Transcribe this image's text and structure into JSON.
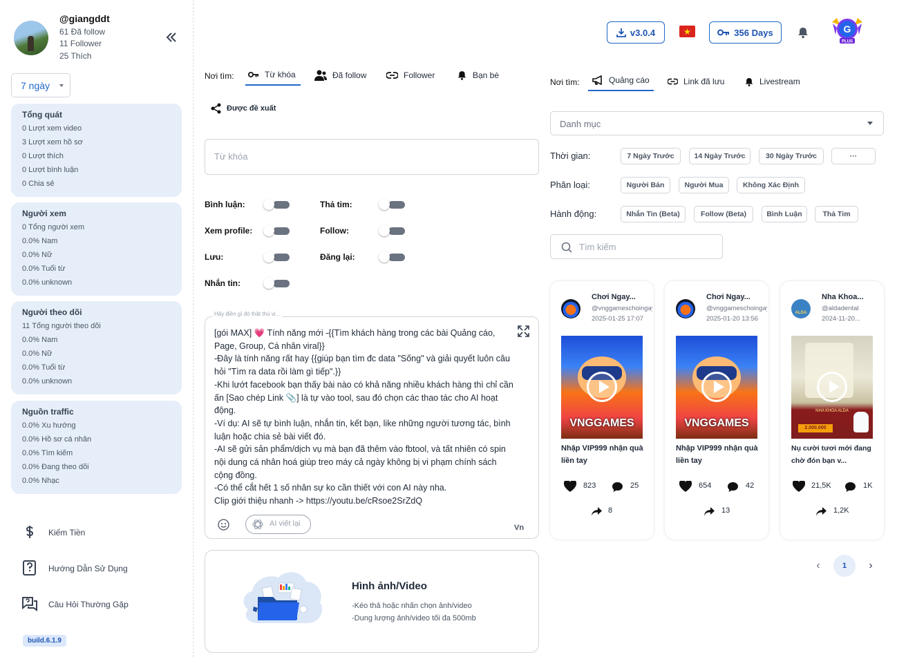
{
  "profile": {
    "username": "@giangddt",
    "following": "61 Đã follow",
    "followers": "11 Follower",
    "likes": "25 Thích"
  },
  "range_select": "7 ngày",
  "stats": [
    {
      "title": "Tổng quát",
      "rows": [
        "0 Lượt xem video",
        "3 Lượt xem hồ sơ",
        "0 Lượt thích",
        "0 Lượt bình luận",
        "0 Chia sẻ"
      ]
    },
    {
      "title": "Người xem",
      "rows": [
        "0 Tổng người xem",
        "0.0% Nam",
        "0.0% Nữ",
        "0.0% Tuổi từ",
        "0.0% unknown"
      ]
    },
    {
      "title": "Người theo dõi",
      "rows": [
        "11 Tổng người theo dõi",
        "0.0% Nam",
        "0.0% Nữ",
        "0.0% Tuổi từ",
        "0.0% unknown"
      ]
    },
    {
      "title": "Nguồn traffic",
      "rows": [
        "0.0% Xu hướng",
        "0.0% Hồ sơ cá nhân",
        "0.0% Tìm kiếm",
        "0.0% Đang theo dõi",
        "0.0% Nhạc"
      ]
    }
  ],
  "nav": {
    "earn": "Kiếm Tiền",
    "guide": "Hướng Dẫn Sử Dụng",
    "faq": "Câu Hỏi Thường Gặp"
  },
  "build": "build.6.1.9",
  "header": {
    "version": "v3.0.4",
    "days": "356 Days",
    "flag_star": "★",
    "badge_letter": "G",
    "badge_text": "PLUS"
  },
  "left_tabs": {
    "label": "Nơi tìm:",
    "items": [
      "Từ khóa",
      "Đã follow",
      "Follower",
      "Bạn bè",
      "Được đề xuất"
    ],
    "active": "Từ khóa"
  },
  "keyword_placeholder": "Từ khóa",
  "toggles": {
    "comment": "Bình luận:",
    "heart": "Thả tim:",
    "view_profile": "Xem profile:",
    "follow": "Follow:",
    "save": "Lưu:",
    "repost": "Đăng lại:",
    "message": "Nhắn tin:"
  },
  "message_box": {
    "label": "Hãy điền gì đó thật thú vị...",
    "text": "[gói MAX] 💗 Tính năng mới -{{Tìm khách hàng trong các bài Quảng cáo, Page, Group, Cá nhân viral}}\n-Đây là tính năng rất hay {{giúp bạn tìm đc data \"Sống\" và giải quyết luôn câu hỏi \"Tìm ra data rồi làm gì tiếp\".}}\n-Khi lướt facebook bạn thấy bài nào có khả năng nhiều khách hàng thì chỉ cần ấn [Sao chép Link 📎] là tự vào tool, sau đó chọn các thao tác cho AI hoạt động.\n-Ví dụ: AI sẽ tự bình luận, nhắn tin, kết bạn, like những người tương tác, bình luận hoặc chia sẻ bài viết đó.\n-AI sẽ gửi sản phẩm/dịch vụ mà bạn đã thêm vào fbtool, và tất nhiên có spin nội dung cá nhân hoá giúp treo máy cả ngày không bị vi phạm chính sách cộng đồng.\n-Có thể cắt hết 1 số nhân sự ko cần thiết với con AI này nha.\nClip giới thiệu nhanh -> https://youtu.be/cRsoe2SrZdQ",
    "ai_button": "AI viết lại",
    "lang": "Vn"
  },
  "upload": {
    "title": "Hình ảnh/Video",
    "line1": "-Kéo thả hoặc nhấn chọn ảnh/video",
    "line2": "-Dung lượng ảnh/video tối đa 500mb"
  },
  "right_tabs": {
    "label": "Nơi tìm:",
    "items": [
      "Quảng cáo",
      "Link đã lưu",
      "Livestream"
    ],
    "active": "Quảng cáo"
  },
  "category_placeholder": "Danh mục",
  "filters": {
    "time": {
      "label": "Thời gian:",
      "chips": [
        "7 Ngày Trước",
        "14 Ngày Trước",
        "30 Ngày Trước",
        "···"
      ]
    },
    "type": {
      "label": "Phân loại:",
      "chips": [
        "Người Bán",
        "Người Mua",
        "Không Xác Định"
      ]
    },
    "action": {
      "label": "Hành động:",
      "chips": [
        "Nhắn Tin (Beta)",
        "Follow (Beta)",
        "Bình Luận",
        "Thả Tim"
      ]
    }
  },
  "search_placeholder": "Tìm kiếm",
  "videos": [
    {
      "name": "Chơi Ngay...",
      "handle": "@vnggameschoingay",
      "date": "2025-01-25 17:07",
      "thumb_text": "VNGGAMES",
      "caption": "Nhập VIP999 nhận quà liền tay",
      "likes": "823",
      "comments": "25",
      "shares": "8"
    },
    {
      "name": "Chơi Ngay...",
      "handle": "@vnggameschoingay",
      "date": "2025-01-20 13:56",
      "thumb_text": "VNGGAMES",
      "caption": "Nhập VIP999 nhận quà liền tay",
      "likes": "654",
      "comments": "42",
      "shares": "13"
    },
    {
      "name": "Nha Khoa...",
      "handle": "@aldadental",
      "date": "2024-11-20...",
      "thumb_text": "NHA KHOA ALDA",
      "thumb_price": "2.000.000",
      "avatar_text": "ALDA",
      "caption": "Nụ cười tươi mới đang chờ đón bạn v...",
      "likes": "21,5K",
      "comments": "1K",
      "shares": "1,2K"
    }
  ],
  "pagination": {
    "prev": "‹",
    "current": "1",
    "next": "›"
  },
  "colors": {
    "accent": "#1e66c9",
    "card_bg": "#e6eef9",
    "toggle_off": "#6b7280"
  }
}
